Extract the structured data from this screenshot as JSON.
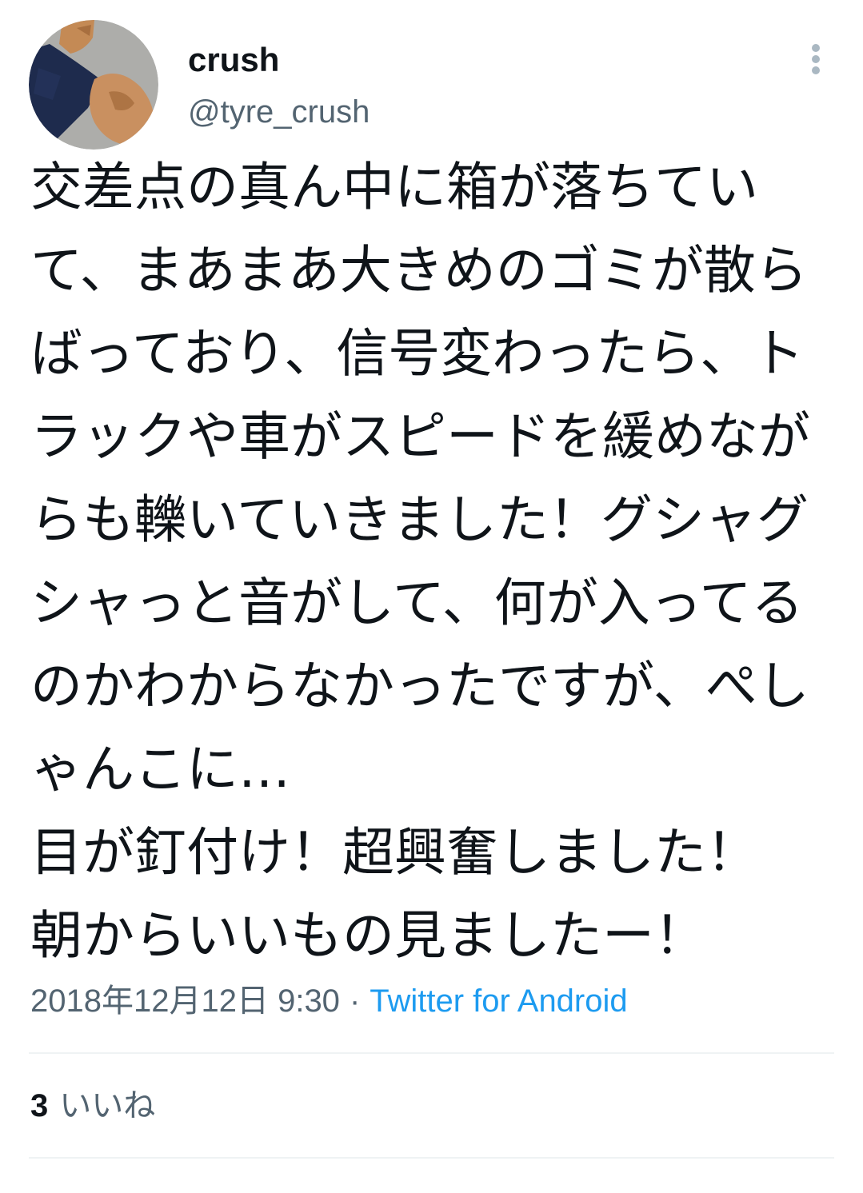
{
  "tweet": {
    "author": {
      "display_name": "crush",
      "handle": "@tyre_crush"
    },
    "more_icon": "more-vertical-icon",
    "text_lines": [
      "交差点の真ん中に箱が落ちてい",
      "て、まあまあ大きめのゴミが散ら",
      "ばっており、信号変わったら、ト",
      "ラックや車がスピードを緩めなが",
      "らも轢いていきました！グシャグ",
      "シャっと音がして、何が入ってる",
      "のかわからなかったですが、ぺし",
      "ゃんこに…",
      "目が釘付け！超興奮しました！",
      "朝からいいもの見ましたー！"
    ],
    "timestamp": "2018年12月12日 9:30",
    "separator": "·",
    "source": "Twitter for Android",
    "likes": {
      "count": "3",
      "label": "いいね"
    }
  },
  "colors": {
    "text": "#0f1419",
    "secondary": "#536471",
    "link": "#1d9bf0",
    "divider": "#eff3f4",
    "icon": "#aab8c2"
  }
}
